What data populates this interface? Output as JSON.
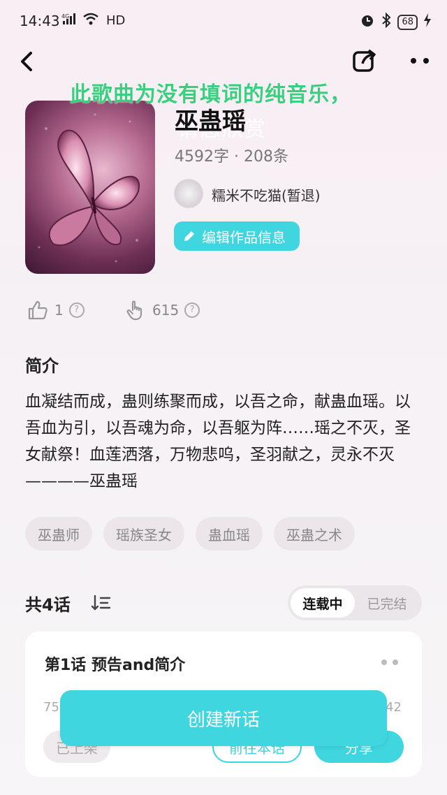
{
  "status_bar": {
    "time": "14:43",
    "network": "4G",
    "hd": "HD",
    "battery": "68"
  },
  "overlay_lyric": "此歌曲为没有填词的纯音乐，",
  "book": {
    "title": "巫蛊瑶",
    "title_ghost": "请您欣赏",
    "meta": "4592字 · 208条",
    "author": "糯米不吃猫(暂退)",
    "edit_label": "编辑作品信息"
  },
  "stats": {
    "likes": "1",
    "views": "615"
  },
  "intro": {
    "heading": "简介",
    "text": "血凝结而成，蛊则练聚而成，以吾之命，献蛊血瑶。以吾血为引，以吾魂为命，以吾躯为阵……瑶之不灭，圣女献祭！血莲洒落，万物悲呜，圣羽献之，灵永不灭————巫蛊瑶"
  },
  "tags": [
    "巫蛊师",
    "瑶族圣女",
    "蛊血瑶",
    "巫蛊之术"
  ],
  "episodes": {
    "count_label": "共4话",
    "toggle": [
      "连载中",
      "已完结"
    ],
    "first": {
      "title": "第1话   预告and简介",
      "left_num": "75",
      "right_num": "42",
      "status": "已上架",
      "goto_label": "前往本话",
      "share_label": "分享"
    }
  },
  "create_label": "创建新话",
  "colors": {
    "accent": "#3fd6e0",
    "lyric": "#38d07e"
  }
}
